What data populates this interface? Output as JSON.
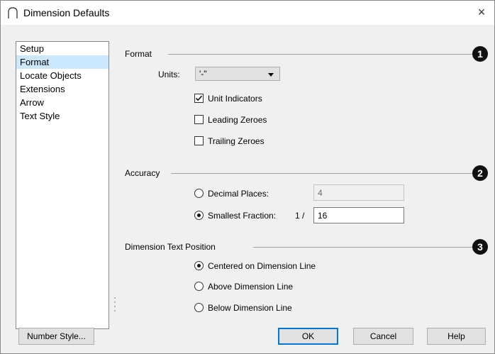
{
  "window": {
    "title": "Dimension Defaults",
    "close_symbol": "×"
  },
  "sidebar": {
    "items": [
      {
        "label": "Setup",
        "selected": false
      },
      {
        "label": "Format",
        "selected": true
      },
      {
        "label": "Locate Objects",
        "selected": false
      },
      {
        "label": "Extensions",
        "selected": false
      },
      {
        "label": "Arrow",
        "selected": false
      },
      {
        "label": "Text Style",
        "selected": false
      }
    ]
  },
  "format": {
    "heading": "Format",
    "badge": "1",
    "units_label": "Units:",
    "units_value": "'-\"",
    "unit_indicators": {
      "label": "Unit Indicators",
      "checked": true
    },
    "leading_zeroes": {
      "label": "Leading Zeroes",
      "checked": false
    },
    "trailing_zeroes": {
      "label": "Trailing Zeroes",
      "checked": false
    }
  },
  "accuracy": {
    "heading": "Accuracy",
    "badge": "2",
    "decimal_places": {
      "label": "Decimal Places:",
      "value": "4",
      "selected": false
    },
    "smallest_fraction": {
      "label": "Smallest Fraction:",
      "prefix": "1 /",
      "value": "16",
      "selected": true
    }
  },
  "text_position": {
    "heading": "Dimension Text Position",
    "badge": "3",
    "centered": {
      "label": "Centered on Dimension Line",
      "selected": true
    },
    "above": {
      "label": "Above Dimension Line",
      "selected": false
    },
    "below": {
      "label": "Below Dimension Line",
      "selected": false
    }
  },
  "buttons": {
    "number_style": "Number Style...",
    "ok": "OK",
    "cancel": "Cancel",
    "help": "Help"
  },
  "colors": {
    "selection": "#cce8ff",
    "default_button_border": "#0078d7",
    "badge": "#111111"
  }
}
